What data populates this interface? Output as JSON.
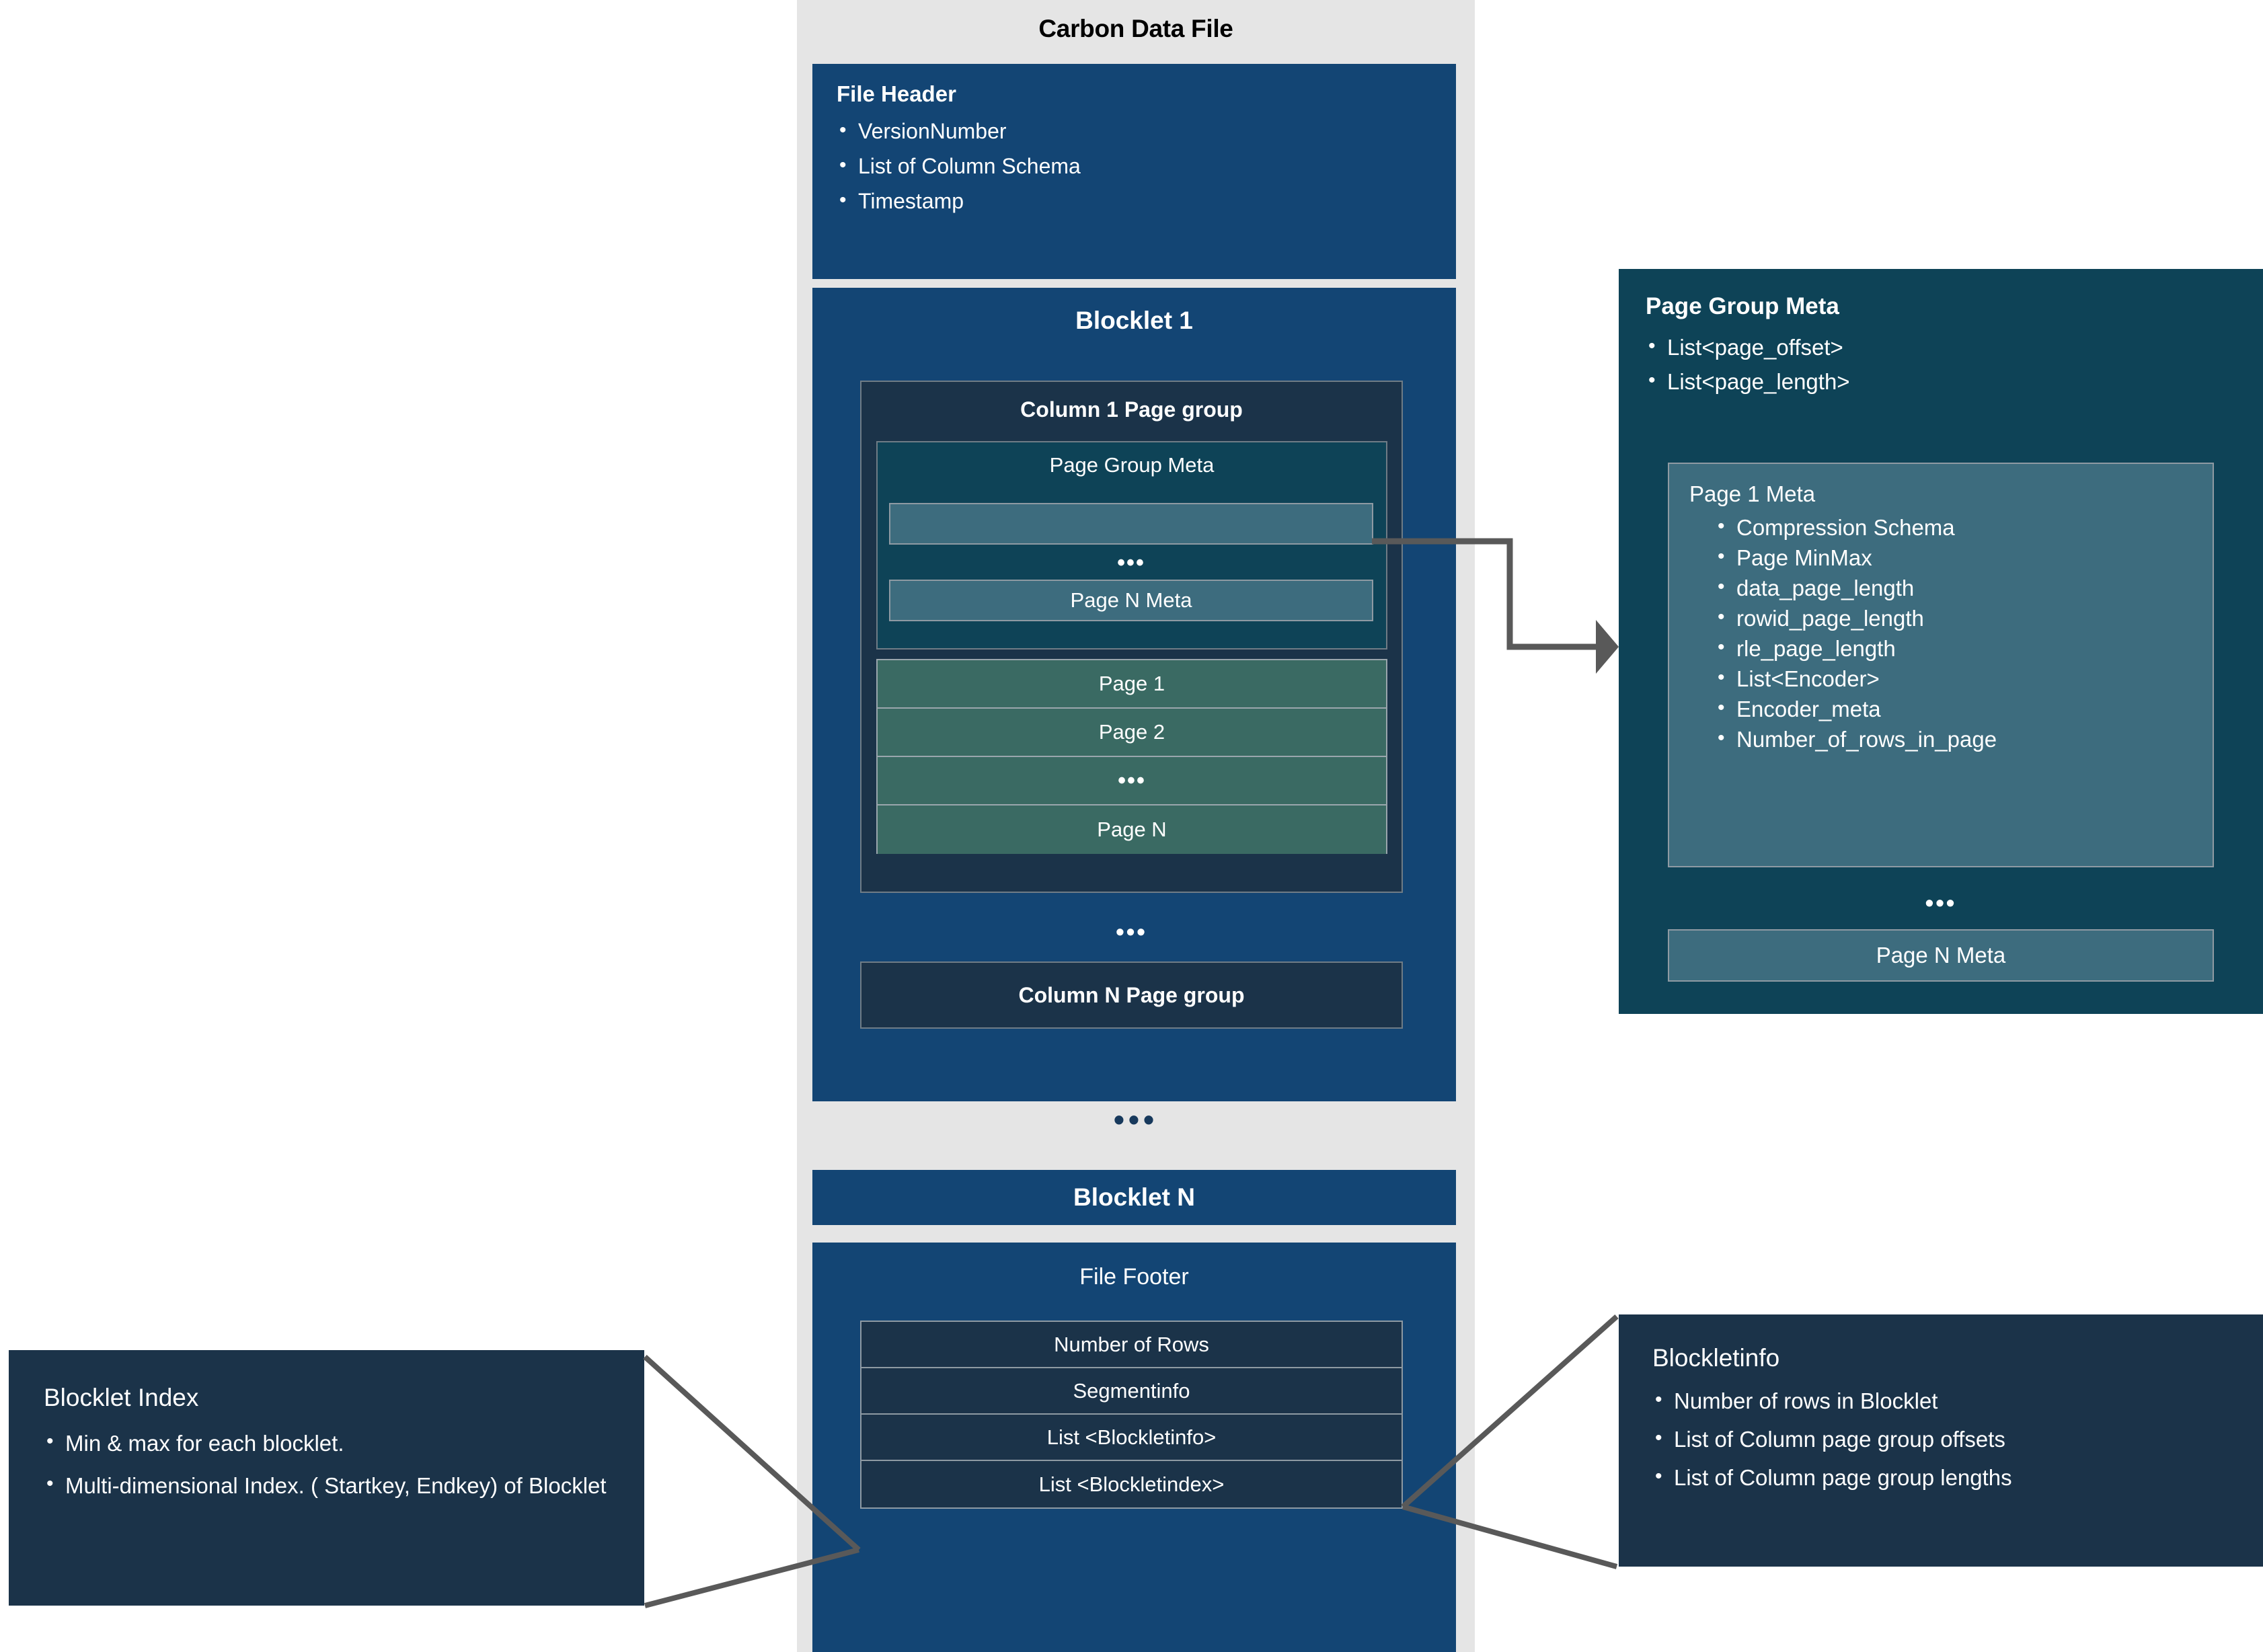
{
  "carbon_file": {
    "title": "Carbon Data File",
    "file_header": {
      "title": "File Header",
      "items": [
        "VersionNumber",
        "List of Column Schema",
        "Timestamp"
      ]
    },
    "blocklet1": {
      "title": "Blocklet 1",
      "column1_page_group": {
        "title": "Column 1 Page group",
        "page_group_meta": {
          "title": "Page Group Meta",
          "slot_first_label": "",
          "ellipsis": "•••",
          "slot_last_label": "Page N Meta"
        },
        "pages": [
          "Page 1",
          "Page 2",
          "•••",
          "Page N"
        ]
      },
      "ellipsis": "•••",
      "columnN_page_group": "Column N Page group"
    },
    "ellipsis_between_blocklets": "•••",
    "blockletN": {
      "title": "Blocklet N"
    },
    "file_footer": {
      "title": "File Footer",
      "rows": [
        "Number of Rows",
        "Segmentinfo",
        "List <Blockletinfo>",
        "List <Blockletindex>"
      ]
    }
  },
  "page_group_meta_panel": {
    "title": "Page Group Meta",
    "items": [
      "List<page_offset>",
      "List<page_length>"
    ],
    "page1_meta": {
      "title": "Page 1 Meta",
      "items": [
        "Compression Schema",
        "Page MinMax",
        "data_page_length",
        "rowid_page_length",
        "rle_page_length",
        "List<Encoder>",
        "Encoder_meta",
        "Number_of_rows_in_page"
      ]
    },
    "ellipsis": "•••",
    "page_n_meta": "Page N Meta"
  },
  "blocklet_index": {
    "title": "Blocklet Index",
    "items": [
      "Min & max for each blocklet.",
      "Multi-dimensional Index. ( Startkey, Endkey) of Blocklet"
    ]
  },
  "blockletinfo": {
    "title": "Blockletinfo",
    "items": [
      "Number of rows in Blocklet",
      "List of Column page group offsets",
      "List of Column page group lengths"
    ]
  },
  "colors": {
    "page_background": "#ffffff",
    "carbon_column_background": "#e5e5e5",
    "blue": "#134574",
    "dark_navy": "#1b3349",
    "teal": "#0e4357",
    "light_teal": "#3d6c7e",
    "green_teal": "#3a6a63",
    "connector_gray": "#595959",
    "border_gray": "#8e9aa3",
    "text_white": "#ffffff",
    "title_black": "#000000"
  }
}
